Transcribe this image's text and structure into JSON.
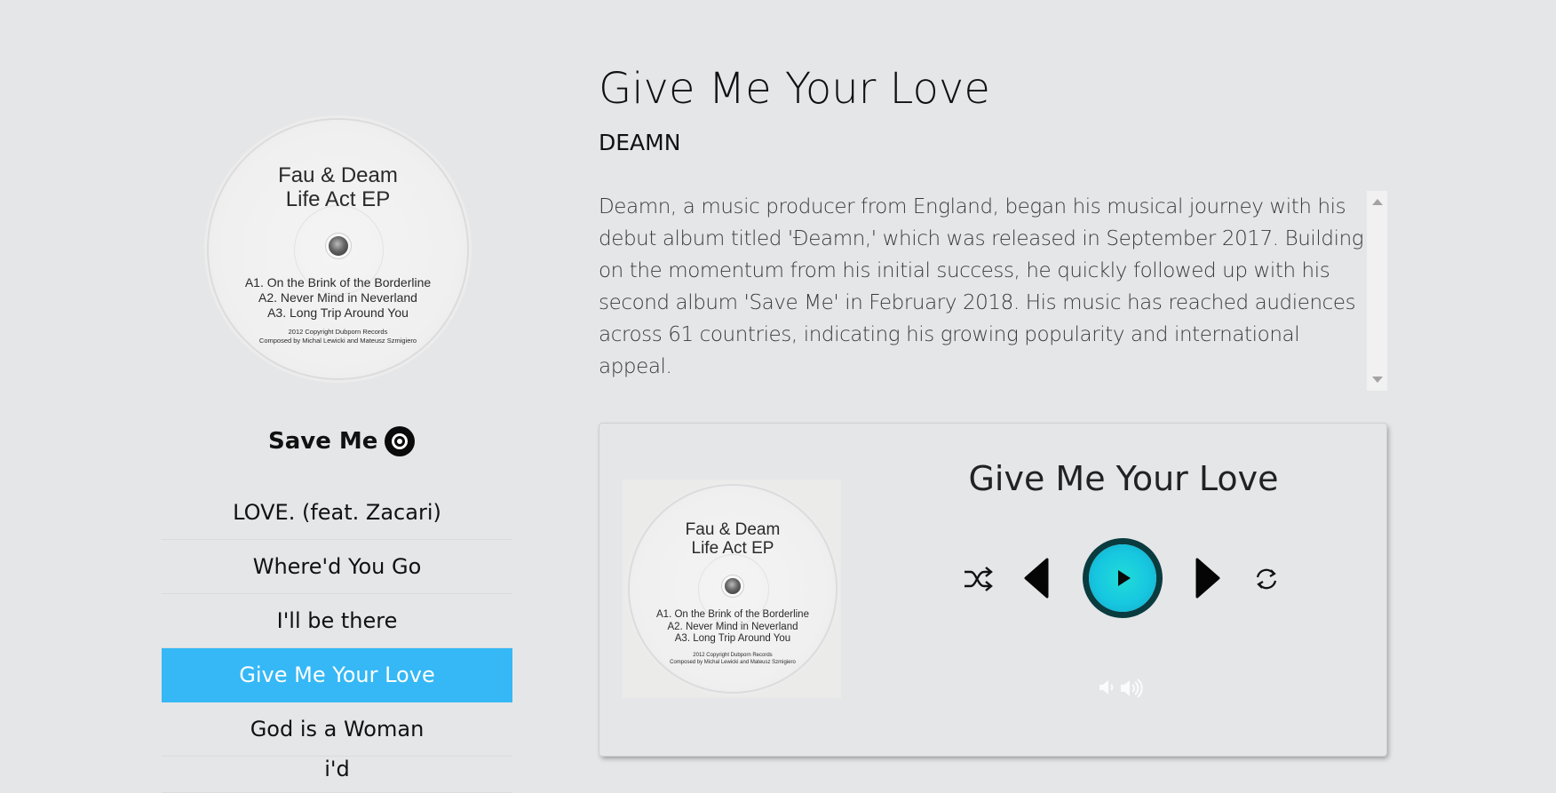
{
  "album": {
    "name": "Save Me",
    "record_label": {
      "artists": "Fau & Deam",
      "release": "Life Act EP",
      "tracks": [
        "A1. On the Brink of the Borderline",
        "A2. Never Mind in Neverland",
        "A3. Long Trip Around You"
      ],
      "copyright": "2012 Copyright Dubporn Records",
      "credits": "Composed by Michal Lewicki and Mateusz Szmigiero"
    }
  },
  "tracklist": [
    {
      "title": "LOVE. (feat. Zacari)",
      "active": false
    },
    {
      "title": "Where'd You Go",
      "active": false
    },
    {
      "title": "I'll be there",
      "active": false
    },
    {
      "title": "Give Me Your Love",
      "active": true
    },
    {
      "title": "God is a Woman",
      "active": false
    },
    {
      "title": "i'd",
      "active": false
    }
  ],
  "song": {
    "title": "Give Me Your Love",
    "artist": "DEAMN",
    "bio": "Deamn, a music producer from England, began his musical journey with his debut album titled 'Đeamn,' which was released in September 2017. Building on the momentum from his initial success, he quickly followed up with his second album 'Save Me' in February 2018. His music has reached audiences across 61 countries, indicating his growing popularity and international appeal."
  },
  "player": {
    "title": "Give Me Your Love",
    "controls": [
      "shuffle-icon",
      "previous-icon",
      "play-icon",
      "next-icon",
      "repeat-icon",
      "volume-down-icon",
      "volume-up-icon"
    ],
    "accent_color": "#1ed0dc"
  },
  "colors": {
    "active_track": "#35b8f5",
    "background": "#e5e6e8"
  }
}
